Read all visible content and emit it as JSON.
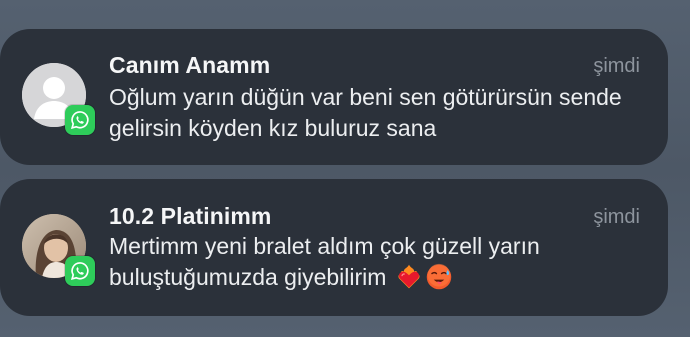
{
  "notifications": [
    {
      "sender": "Canım Anamm",
      "time": "şimdi",
      "message": "Oğlum yarın düğün var beni sen götürürsün sende gelirsin köyden kız buluruz sana",
      "app_icon": "whatsapp-icon",
      "avatar": "default-person-avatar"
    },
    {
      "sender": "10.2 Platinimm",
      "time": "şimdi",
      "message": "Mertimm yeni bralet aldım çok güzell yarın buluştuğumuzda giyebilirim",
      "emojis": [
        "heart-on-fire-emoji",
        "hot-face-emoji"
      ],
      "app_icon": "whatsapp-icon",
      "avatar": "photo-avatar"
    }
  ],
  "colors": {
    "background": "#4a5664",
    "card": "#2b313a",
    "whatsapp_green": "#2ecc5a",
    "time_text": "#8d949d"
  }
}
